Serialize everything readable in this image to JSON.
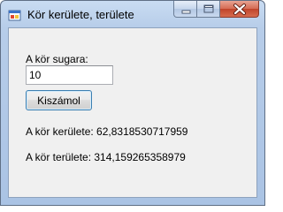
{
  "window": {
    "title": "Kör kerülete, területe"
  },
  "form": {
    "radius_label": "A kör sugara:",
    "radius_value": "10",
    "calculate_button": "Kiszámol",
    "circumference_text": "A kör kerülete: 62,8318530717959",
    "area_text": "A kör területe: 314,159265358979"
  },
  "icons": {
    "app": "app-window-icon",
    "minimize": "minimize-icon",
    "maximize": "maximize-icon",
    "close": "close-icon"
  }
}
